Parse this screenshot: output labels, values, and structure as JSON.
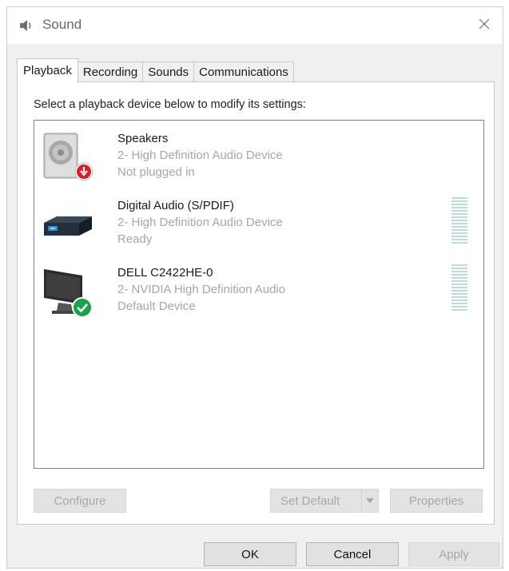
{
  "window": {
    "title": "Sound",
    "title_icon": "speaker-icon",
    "close_icon": "close-icon"
  },
  "tabs": [
    {
      "label": "Playback",
      "active": true
    },
    {
      "label": "Recording",
      "active": false
    },
    {
      "label": "Sounds",
      "active": false
    },
    {
      "label": "Communications",
      "active": false
    }
  ],
  "playback": {
    "instruction": "Select a playback device below to modify its settings:",
    "devices": [
      {
        "name": "Speakers",
        "description": "2- High Definition Audio Device",
        "status": "Not plugged in",
        "icon": "speaker-device-icon",
        "badge": "unplugged-badge-icon"
      },
      {
        "name": "Digital Audio (S/PDIF)",
        "description": "2- High Definition Audio Device",
        "status": "Ready",
        "icon": "digital-audio-device-icon"
      },
      {
        "name": "DELL C2422HE-0",
        "description": "2- NVIDIA High Definition Audio",
        "status": "Default Device",
        "icon": "monitor-device-icon",
        "badge": "default-check-badge-icon"
      }
    ],
    "buttons": {
      "configure": "Configure",
      "set_default": "Set Default",
      "properties": "Properties"
    }
  },
  "footer": {
    "ok": "OK",
    "cancel": "Cancel",
    "apply": "Apply"
  },
  "colors": {
    "accent_check": "#16a34a",
    "unplugged_red": "#d4202b",
    "meter": "#b8dcd6"
  }
}
